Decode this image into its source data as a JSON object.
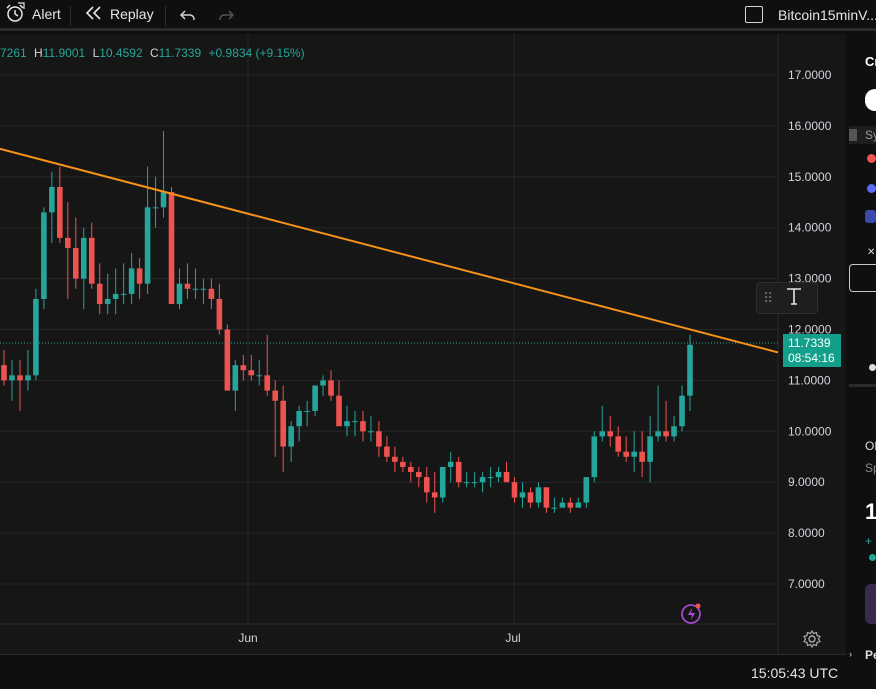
{
  "topbar": {
    "alert_label": "Alert",
    "replay_label": "Replay",
    "layout_name": "Bitcoin15minV..."
  },
  "legend": {
    "open_partial": "7261",
    "h_label": "H",
    "h_value": "11.9001",
    "l_label": "L",
    "l_value": "10.4592",
    "c_label": "C",
    "c_value": "11.7339",
    "change": "+0.9834 (+9.15%)"
  },
  "price_axis": {
    "ticks": [
      "17.0000",
      "16.0000",
      "15.0000",
      "14.0000",
      "13.0000",
      "12.0000",
      "11.0000",
      "10.0000",
      "9.0000",
      "8.0000",
      "7.0000"
    ],
    "last_price": "11.7339",
    "countdown": "08:54:16"
  },
  "time_axis": {
    "labels": [
      "Jun",
      "Jul"
    ],
    "clock": "15:05:43 UTC"
  },
  "right_panel": {
    "partial_1": "Cr",
    "partial_2": "Sy",
    "partial_3": "OF",
    "partial_4": "Sp",
    "partial_5": "Pe"
  },
  "colors": {
    "up": "#26a69a",
    "down": "#ef5350",
    "trendline": "#f7931a",
    "background": "#161616"
  },
  "chart_data": {
    "type": "candlestick",
    "yaxis": {
      "min": 7,
      "max": 17
    },
    "trendline": {
      "color": "#f7931a",
      "from_value": 15.55,
      "to_value": 11.55
    },
    "candles": [
      [
        11.3,
        11.6,
        10.9,
        11.0
      ],
      [
        11.0,
        11.4,
        10.6,
        11.1
      ],
      [
        11.1,
        11.4,
        10.4,
        11.0
      ],
      [
        11.0,
        11.6,
        10.8,
        11.1
      ],
      [
        11.1,
        12.8,
        11.0,
        12.6
      ],
      [
        12.6,
        14.4,
        12.4,
        14.3
      ],
      [
        14.3,
        15.1,
        13.7,
        14.8
      ],
      [
        14.8,
        15.2,
        13.7,
        13.8
      ],
      [
        13.8,
        14.5,
        12.6,
        13.6
      ],
      [
        13.6,
        14.2,
        12.8,
        13.0
      ],
      [
        13.0,
        14.0,
        12.4,
        13.8
      ],
      [
        13.8,
        14.1,
        12.8,
        12.9
      ],
      [
        12.9,
        13.3,
        12.3,
        12.5
      ],
      [
        12.5,
        13.1,
        12.3,
        12.6
      ],
      [
        12.6,
        13.2,
        12.3,
        12.7
      ],
      [
        12.7,
        13.3,
        12.5,
        12.7
      ],
      [
        12.7,
        13.5,
        12.5,
        13.2
      ],
      [
        13.2,
        13.4,
        12.6,
        12.9
      ],
      [
        12.9,
        15.2,
        12.7,
        14.4
      ],
      [
        14.4,
        15.0,
        14.0,
        14.4
      ],
      [
        14.4,
        15.9,
        14.2,
        14.7
      ],
      [
        14.7,
        14.8,
        12.5,
        12.5
      ],
      [
        12.5,
        13.2,
        12.4,
        12.9
      ],
      [
        12.9,
        13.3,
        12.6,
        12.8
      ],
      [
        12.8,
        13.2,
        12.6,
        12.8
      ],
      [
        12.8,
        13.0,
        12.5,
        12.8
      ],
      [
        12.8,
        13.0,
        12.4,
        12.6
      ],
      [
        12.6,
        12.9,
        11.9,
        12.0
      ],
      [
        12.0,
        12.1,
        10.8,
        10.8
      ],
      [
        10.8,
        11.4,
        10.4,
        11.3
      ],
      [
        11.3,
        11.5,
        11.0,
        11.2
      ],
      [
        11.2,
        11.5,
        11.0,
        11.1
      ],
      [
        11.1,
        11.4,
        10.9,
        11.1
      ],
      [
        11.1,
        11.9,
        10.7,
        10.8
      ],
      [
        10.8,
        11.0,
        9.5,
        10.6
      ],
      [
        10.6,
        10.9,
        9.2,
        9.7
      ],
      [
        9.7,
        10.2,
        9.4,
        10.1
      ],
      [
        10.1,
        10.5,
        9.8,
        10.4
      ],
      [
        10.4,
        10.6,
        10.1,
        10.4
      ],
      [
        10.4,
        10.9,
        10.3,
        10.9
      ],
      [
        10.9,
        11.1,
        10.7,
        11.0
      ],
      [
        11.0,
        11.2,
        10.6,
        10.7
      ],
      [
        10.7,
        11.0,
        10.1,
        10.1
      ],
      [
        10.1,
        10.5,
        9.9,
        10.2
      ],
      [
        10.2,
        10.4,
        9.9,
        10.2
      ],
      [
        10.2,
        10.4,
        9.8,
        10.0
      ],
      [
        10.0,
        10.3,
        9.8,
        10.0
      ],
      [
        10.0,
        10.2,
        9.5,
        9.7
      ],
      [
        9.7,
        9.9,
        9.4,
        9.5
      ],
      [
        9.5,
        9.7,
        9.2,
        9.4
      ],
      [
        9.4,
        9.5,
        9.2,
        9.3
      ],
      [
        9.3,
        9.4,
        9.0,
        9.2
      ],
      [
        9.2,
        9.3,
        8.9,
        9.1
      ],
      [
        9.1,
        9.3,
        8.6,
        8.8
      ],
      [
        8.8,
        9.2,
        8.4,
        8.7
      ],
      [
        8.7,
        9.3,
        8.6,
        9.3
      ],
      [
        9.3,
        9.6,
        9.0,
        9.4
      ],
      [
        9.4,
        9.5,
        8.9,
        9.0
      ],
      [
        9.0,
        9.2,
        8.9,
        9.0
      ],
      [
        9.0,
        9.2,
        8.9,
        9.0
      ],
      [
        9.0,
        9.2,
        8.8,
        9.1
      ],
      [
        9.1,
        9.3,
        8.9,
        9.1
      ],
      [
        9.1,
        9.3,
        9.0,
        9.2
      ],
      [
        9.2,
        9.4,
        9.0,
        9.0
      ],
      [
        9.0,
        9.1,
        8.6,
        8.7
      ],
      [
        8.7,
        9.0,
        8.5,
        8.8
      ],
      [
        8.8,
        8.9,
        8.5,
        8.6
      ],
      [
        8.6,
        9.0,
        8.5,
        8.9
      ],
      [
        8.9,
        8.9,
        8.4,
        8.5
      ],
      [
        8.5,
        8.7,
        8.4,
        8.5
      ],
      [
        8.5,
        8.7,
        8.5,
        8.6
      ],
      [
        8.6,
        8.7,
        8.4,
        8.5
      ],
      [
        8.5,
        8.7,
        8.5,
        8.6
      ],
      [
        8.6,
        9.1,
        8.5,
        9.1
      ],
      [
        9.1,
        10.0,
        9.0,
        9.9
      ],
      [
        9.9,
        10.5,
        9.8,
        10.0
      ],
      [
        10.0,
        10.3,
        9.7,
        9.9
      ],
      [
        9.9,
        10.1,
        9.5,
        9.6
      ],
      [
        9.6,
        9.9,
        9.4,
        9.5
      ],
      [
        9.5,
        10.0,
        9.2,
        9.6
      ],
      [
        9.6,
        10.0,
        9.1,
        9.4
      ],
      [
        9.4,
        10.3,
        9.0,
        9.9
      ],
      [
        9.9,
        10.9,
        9.8,
        10.0
      ],
      [
        10.0,
        10.6,
        9.8,
        9.9
      ],
      [
        9.9,
        10.3,
        9.8,
        10.1
      ],
      [
        10.1,
        10.9,
        10.0,
        10.7
      ],
      [
        10.7,
        11.9,
        10.4,
        11.7
      ]
    ]
  }
}
